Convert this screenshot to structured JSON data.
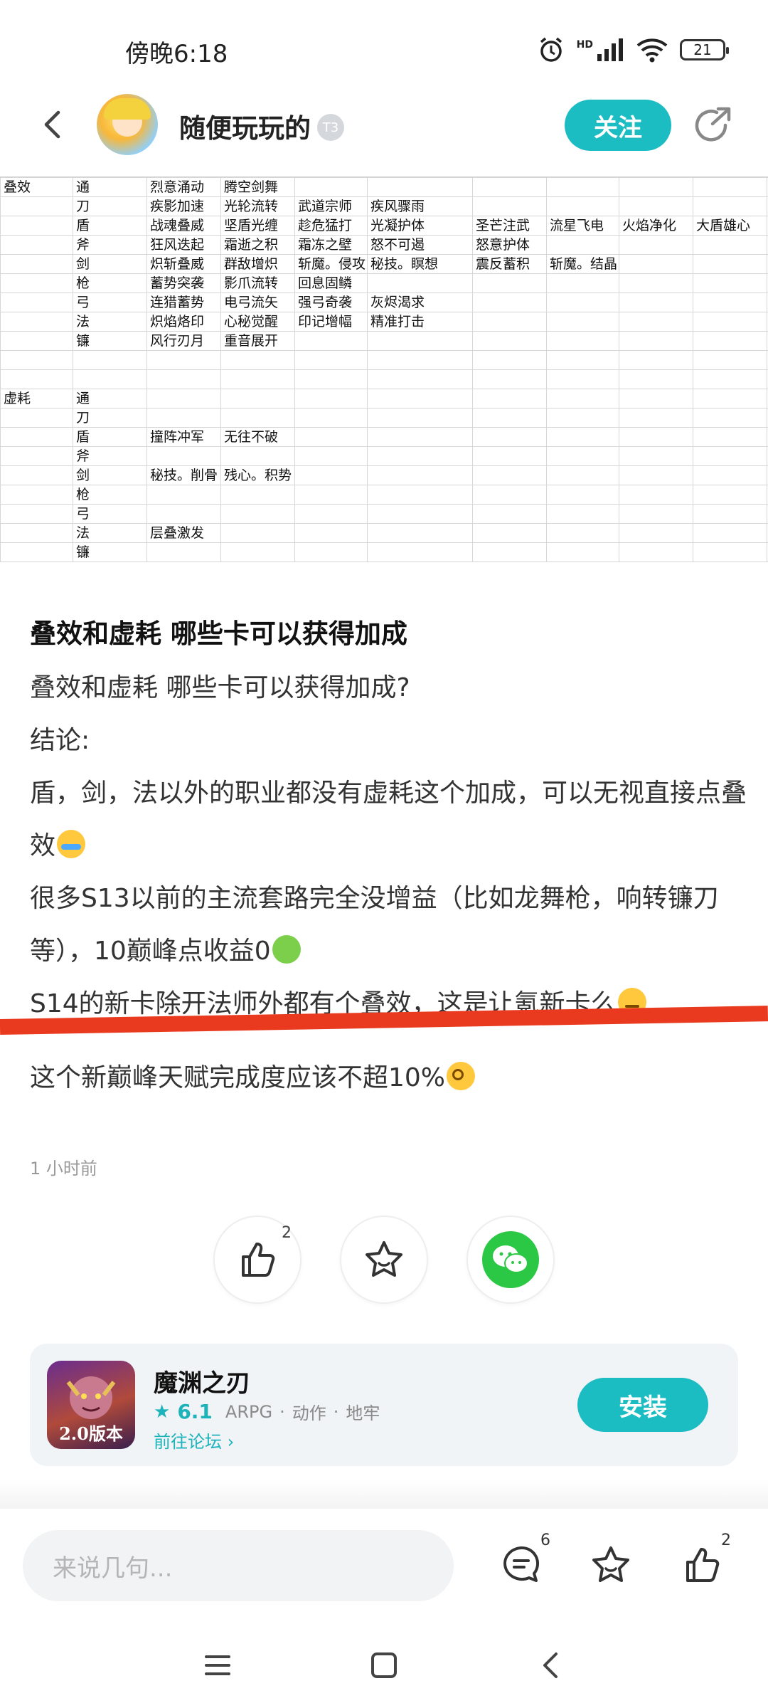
{
  "status_bar": {
    "time": "傍晚6:18",
    "hd_label": "HD",
    "battery": "21"
  },
  "header": {
    "username": "随便玩玩的",
    "badge": "T3",
    "follow_label": "关注"
  },
  "spreadsheet": {
    "rows": [
      [
        "叠效",
        "通",
        "烈意涌动",
        "腾空剑舞",
        "",
        "",
        "",
        "",
        "",
        "",
        ""
      ],
      [
        "",
        "刀",
        "疾影加速",
        "光轮流转",
        "武道宗师",
        "疾风骤雨",
        "",
        "",
        "",
        "",
        ""
      ],
      [
        "",
        "盾",
        "战魂叠威",
        "坚盾光缠",
        "趁危猛打",
        "光凝护体",
        "圣芒注武",
        "流星飞电",
        "火焰净化",
        "大盾雄心",
        ""
      ],
      [
        "",
        "斧",
        "狂风迭起",
        "霜逝之积",
        "霜冻之壁",
        "怒不可遏",
        "怒意护体",
        "",
        "",
        "",
        ""
      ],
      [
        "",
        "剑",
        "炽斩叠威",
        "群敌增炽",
        "斩魔。侵攻",
        "秘技。瞑想",
        "震反蓄积",
        "斩魔。结晶",
        "",
        "",
        ""
      ],
      [
        "",
        "枪",
        "蓄势突袭",
        "影爪流转",
        "回息固鳞",
        "",
        "",
        "",
        "",
        "",
        ""
      ],
      [
        "",
        "弓",
        "连猎蓄势",
        "电弓流矢",
        "强弓奇袭",
        "灰烬渴求",
        "",
        "",
        "",
        "",
        ""
      ],
      [
        "",
        "法",
        "炽焰烙印",
        "心秘觉醒",
        "印记增幅",
        "精准打击",
        "",
        "",
        "",
        "",
        ""
      ],
      [
        "",
        "镰",
        "风行刃月",
        "重音展开",
        "",
        "",
        "",
        "",
        "",
        "",
        ""
      ],
      [
        "",
        "",
        "",
        "",
        "",
        "",
        "",
        "",
        "",
        "",
        ""
      ],
      [
        "",
        "",
        "",
        "",
        "",
        "",
        "",
        "",
        "",
        "",
        ""
      ],
      [
        "虚耗",
        "通",
        "",
        "",
        "",
        "",
        "",
        "",
        "",
        "",
        ""
      ],
      [
        "",
        "刀",
        "",
        "",
        "",
        "",
        "",
        "",
        "",
        "",
        ""
      ],
      [
        "",
        "盾",
        "撞阵冲军",
        "无往不破",
        "",
        "",
        "",
        "",
        "",
        "",
        ""
      ],
      [
        "",
        "斧",
        "",
        "",
        "",
        "",
        "",
        "",
        "",
        "",
        ""
      ],
      [
        "",
        "剑",
        "秘技。削骨",
        "残心。积势",
        "",
        "",
        "",
        "",
        "",
        "",
        ""
      ],
      [
        "",
        "枪",
        "",
        "",
        "",
        "",
        "",
        "",
        "",
        "",
        ""
      ],
      [
        "",
        "弓",
        "",
        "",
        "",
        "",
        "",
        "",
        "",
        "",
        ""
      ],
      [
        "",
        "法",
        "层叠激发",
        "",
        "",
        "",
        "",
        "",
        "",
        "",
        ""
      ],
      [
        "",
        "镰",
        "",
        "",
        "",
        "",
        "",
        "",
        "",
        "",
        ""
      ]
    ]
  },
  "post": {
    "title": "叠效和虚耗 哪些卡可以获得加成",
    "lines": [
      "叠效和虚耗 哪些卡可以获得加成?",
      "结论:",
      "盾，剑，法以外的职业都没有虚耗这个加成，可以无视直接点叠效",
      "很多S13以前的主流套路完全没增益（比如龙舞枪，响转镰刀等），10巅峰点收益0",
      "S14的新卡除开法师外都有个叠效，这是让氪新卡么",
      "这个新巅峰天赋完成度应该不超10%"
    ],
    "time_ago": "1 小时前"
  },
  "actions": {
    "like_count": "2"
  },
  "app_card": {
    "name": "魔渊之刃",
    "rating": "6.1",
    "tags": [
      "ARPG",
      "动作",
      "地牢"
    ],
    "forum_link": "前往论坛",
    "install_label": "安装",
    "icon_label": "2.0版本"
  },
  "bottom_bar": {
    "placeholder": "来说几句...",
    "comment_count": "6",
    "like_count": "2"
  },
  "colors": {
    "accent": "#1cbcc3",
    "red_mark": "#e93a1f",
    "wechat": "#2bc845"
  }
}
